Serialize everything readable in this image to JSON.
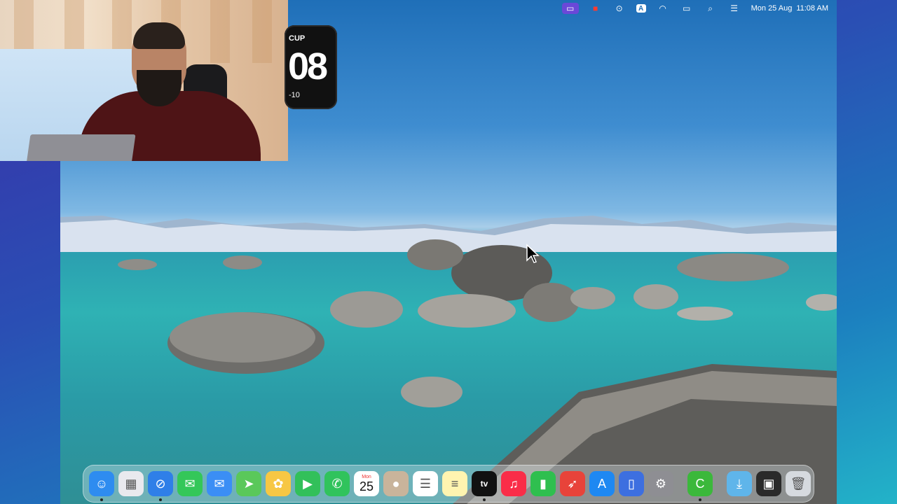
{
  "menubar": {
    "date": "Mon 25 Aug",
    "time": "11:08 AM",
    "icons": [
      "screen-recorder-icon",
      "red-record-icon",
      "play-circle-icon",
      "input-source-icon",
      "wifi-icon",
      "battery-icon",
      "spotlight-search-icon",
      "control-center-icon"
    ],
    "input_source_letter": "A"
  },
  "widget": {
    "top_label": "CUP",
    "main_number": "08",
    "bottom_label": "-10"
  },
  "dock": {
    "calendar": {
      "month": "Mon",
      "day": "25"
    },
    "tv_label": "tv",
    "items": [
      {
        "name": "finder",
        "color": "#2e8cf0",
        "glyph": "☺",
        "running": true
      },
      {
        "name": "launchpad",
        "color": "#e9e9ee",
        "glyph": "▦",
        "running": false
      },
      {
        "name": "safari",
        "color": "#2f7fe8",
        "glyph": "⊘",
        "running": true
      },
      {
        "name": "messages",
        "color": "#34c759",
        "glyph": "✉",
        "running": false
      },
      {
        "name": "mail",
        "color": "#3b8ef5",
        "glyph": "✉",
        "running": false
      },
      {
        "name": "maps",
        "color": "#5ac85a",
        "glyph": "➤",
        "running": false
      },
      {
        "name": "photos",
        "color": "#f7c744",
        "glyph": "✿",
        "running": false
      },
      {
        "name": "facetime",
        "color": "#32c05a",
        "glyph": "▶",
        "running": false
      },
      {
        "name": "phone",
        "color": "#30c35c",
        "glyph": "✆",
        "running": false
      },
      {
        "name": "calendar",
        "color": "#ffffff",
        "glyph": "",
        "running": false
      },
      {
        "name": "contacts",
        "color": "#c9b49b",
        "glyph": "●",
        "running": false
      },
      {
        "name": "reminders",
        "color": "#ffffff",
        "glyph": "☰",
        "running": false
      },
      {
        "name": "notes",
        "color": "#fff4b0",
        "glyph": "≡",
        "running": false
      },
      {
        "name": "apple-tv",
        "color": "#111111",
        "glyph": "",
        "running": true
      },
      {
        "name": "music",
        "color": "#fa2d48",
        "glyph": "♫",
        "running": false
      },
      {
        "name": "numbers",
        "color": "#2fbf4f",
        "glyph": "▮",
        "running": false
      },
      {
        "name": "rocket-typist",
        "color": "#e8433a",
        "glyph": "➶",
        "running": false
      },
      {
        "name": "app-store",
        "color": "#1e88f2",
        "glyph": "A",
        "running": false
      },
      {
        "name": "iphone-mirroring",
        "color": "#3d6fe0",
        "glyph": "▯",
        "running": false
      },
      {
        "name": "system-settings",
        "color": "#8e8e93",
        "glyph": "⚙",
        "running": false
      }
    ],
    "recent_items": [
      {
        "name": "camtasia",
        "color": "#3bb83b",
        "glyph": "C",
        "running": true
      }
    ],
    "right_items": [
      {
        "name": "downloads-folder",
        "color": "#5fb5ea",
        "glyph": "⤓"
      },
      {
        "name": "screenshot-folder",
        "color": "#2a2a2a",
        "glyph": "▣"
      },
      {
        "name": "trash",
        "color": "#d6dadf",
        "glyph": "🗑"
      }
    ]
  }
}
